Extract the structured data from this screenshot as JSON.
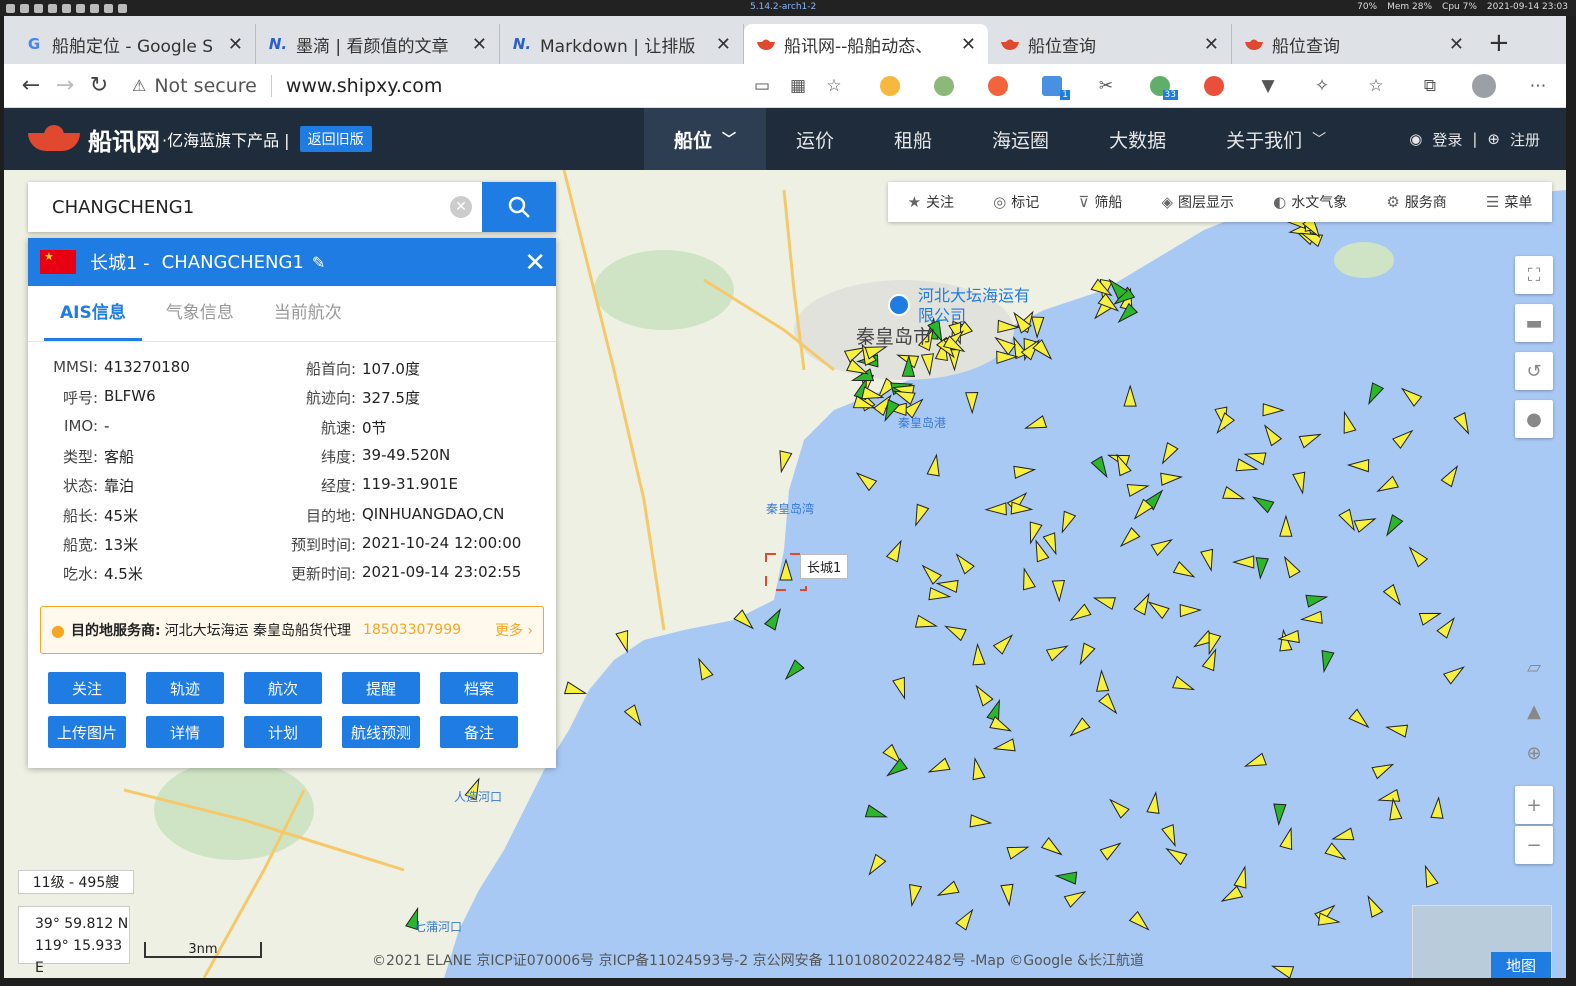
{
  "system": {
    "kernel": "5.14.2-arch1-2",
    "volume": "70%",
    "mem": "Mem 28%",
    "cpu": "Cpu 7%",
    "clock": "2021-09-14 23:03"
  },
  "tabs": [
    {
      "title": "船舶定位 - Google S",
      "favicon": "G",
      "color": "#4285f4",
      "active": false
    },
    {
      "title": "墨滴 | 看颜值的文章",
      "favicon": "N.",
      "color": "#2b5fc9",
      "active": false
    },
    {
      "title": "Markdown | 让排版",
      "favicon": "N.",
      "color": "#2b5fc9",
      "active": false
    },
    {
      "title": "船讯网--船舶动态、",
      "favicon": "boat",
      "color": "#e0482f",
      "active": true
    },
    {
      "title": "船位查询",
      "favicon": "boat",
      "color": "#e0482f",
      "active": false
    },
    {
      "title": "船位查询",
      "favicon": "boat",
      "color": "#e0482f",
      "active": false
    }
  ],
  "toolbar": {
    "security": "Not secure",
    "url": "www.shipxy.com",
    "ext_badge_1": "1",
    "ext_badge_2": "33"
  },
  "site": {
    "brand": "船讯网",
    "tagline": "·亿海蓝旗下产品 |",
    "old_version": "返回旧版",
    "nav": [
      "船位",
      "运价",
      "租船",
      "海运圈",
      "大数据",
      "关于我们"
    ],
    "login": "登录",
    "register": "注册"
  },
  "search": {
    "value": "CHANGCHENG1"
  },
  "ship": {
    "header_cn": "长城1 -",
    "header_en": "CHANGCHENG1",
    "tabs": [
      "AIS信息",
      "气象信息",
      "当前航次"
    ],
    "fields_left": [
      {
        "k": "MMSI:",
        "v": "413270180"
      },
      {
        "k": "呼号:",
        "v": "BLFW6"
      },
      {
        "k": "IMO:",
        "v": "-"
      },
      {
        "k": "类型:",
        "v": "客船"
      },
      {
        "k": "状态:",
        "v": "靠泊"
      },
      {
        "k": "船长:",
        "v": "45米"
      },
      {
        "k": "船宽:",
        "v": "13米"
      },
      {
        "k": "吃水:",
        "v": "4.5米"
      }
    ],
    "fields_right": [
      {
        "k": "船首向:",
        "v": "107.0度"
      },
      {
        "k": "航迹向:",
        "v": "327.5度"
      },
      {
        "k": "航速:",
        "v": "0节"
      },
      {
        "k": "纬度:",
        "v": "39-49.520N"
      },
      {
        "k": "经度:",
        "v": "119-31.901E"
      },
      {
        "k": "目的地:",
        "v": "QINHUANGDAO,CN"
      },
      {
        "k": "预到时间:",
        "v": "2021-10-24 12:00:00"
      },
      {
        "k": "更新时间:",
        "v": "2021-09-14 23:02:55"
      }
    ],
    "service_label": "目的地服务商:",
    "service_text": "河北大坛海运  秦皇岛船货代理",
    "service_phone": "18503307999",
    "service_more": "更多 ›",
    "actions": [
      "关注",
      "轨迹",
      "航次",
      "提醒",
      "档案",
      "上传图片",
      "详情",
      "计划",
      "航线预测",
      "备注"
    ]
  },
  "tools": [
    "关注",
    "标记",
    "筛船",
    "图层显示",
    "水文气象",
    "服务商",
    "菜单"
  ],
  "map": {
    "labels": {
      "company": "河北大坛海运有",
      "company2": "限公司",
      "city": "秦皇岛市",
      "port": "秦皇岛港",
      "bay": "秦皇岛湾",
      "river1": "人造河口",
      "river2": "七蒲河口",
      "ship_name": "长城1"
    },
    "level": "11级 - 495艘",
    "coord_lat": "39° 59.812 N",
    "coord_lon": "119° 15.933 E",
    "scale": "3nm",
    "copyright": "©2021 ELANE  京ICP证070006号  京ICP备11024593号-2    京公网安备 11010802022482号  -Map ©Google &长江航道",
    "maptype": "地图"
  }
}
